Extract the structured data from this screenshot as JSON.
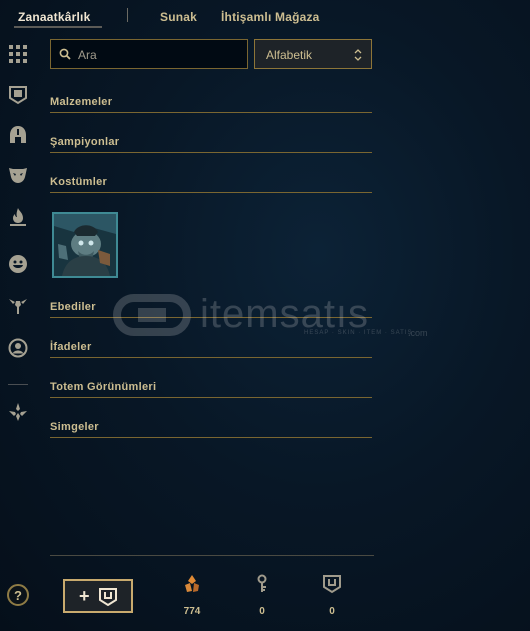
{
  "tabs": [
    {
      "label": "Zanaatkârlık",
      "active": true
    },
    {
      "label": "Sunak",
      "active": false
    },
    {
      "label": "İhtişamlı Mağaza",
      "active": false
    }
  ],
  "rail": {
    "icons": [
      "grid-icon",
      "chest-icon",
      "helmet-icon",
      "mask-icon",
      "flame-icon",
      "emote-icon",
      "totem-icon",
      "profile-icon",
      "summoner-icon"
    ]
  },
  "search": {
    "placeholder": "Ara"
  },
  "sort": {
    "selected": "Alfabetik"
  },
  "sections": [
    {
      "label": "Malzemeler"
    },
    {
      "label": "Şampiyonlar"
    },
    {
      "label": "Kostümler"
    },
    {
      "label": "Ebediler"
    },
    {
      "label": "İfadeler"
    },
    {
      "label": "Totem Görünümleri"
    },
    {
      "label": "Simgeler"
    }
  ],
  "watermark": {
    "text": "itemsatıs",
    "sub": "HESAP · SKIN · ITEM · SATIŞ",
    "domain": ".com"
  },
  "footer": {
    "help_label": "?",
    "add_label": "+",
    "currencies": [
      {
        "icon": "orange-essence-icon",
        "amount": "774",
        "color": "#d9893a"
      },
      {
        "icon": "key-icon",
        "amount": "0",
        "color": "#a09b8c"
      },
      {
        "icon": "chest-icon",
        "amount": "0",
        "color": "#a09b8c"
      }
    ]
  },
  "colors": {
    "gold": "#c8aa6e",
    "gold_dim": "#7a6631",
    "text": "#cdbe91",
    "bg": "#081726"
  }
}
